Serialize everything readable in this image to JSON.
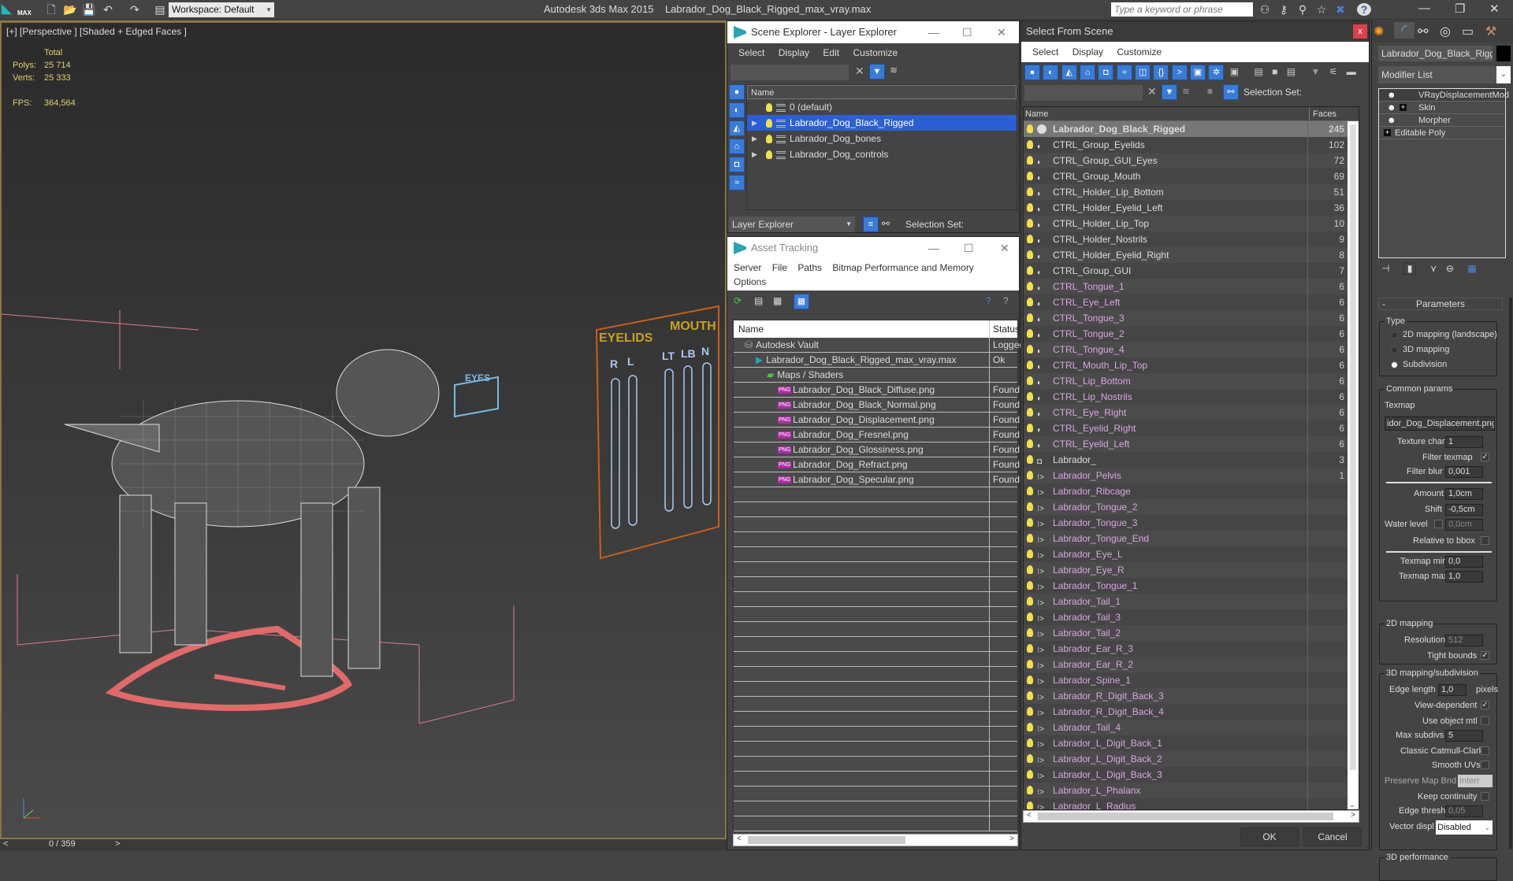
{
  "app": {
    "title": "Autodesk 3ds Max  2015",
    "file": "Labrador_Dog_Black_Rigged_max_vray.max",
    "logo_label": "MAX",
    "workspace": "Workspace: Default",
    "search_placeholder": "Type a keyword or phrase"
  },
  "viewport": {
    "label": "[+] [Perspective ] [Shaded + Edged Faces ]",
    "stats": {
      "total_label": "Total",
      "polys_label": "Polys:",
      "polys": "25 714",
      "verts_label": "Verts:",
      "verts": "25 333",
      "fps_label": "FPS:",
      "fps": "364,564"
    },
    "gui_labels": {
      "eyes": "EYES",
      "eyelids": "EYELIDS",
      "mouth": "MOUTH",
      "r": "R",
      "l": "L",
      "lt": "LT",
      "lb": "LB",
      "n": "N"
    },
    "timeline": {
      "frame": "0 / 359",
      "prev": "<",
      "next": ">"
    }
  },
  "scene_explorer": {
    "title": "Scene Explorer - Layer Explorer",
    "menu": [
      "Select",
      "Display",
      "Edit",
      "Customize"
    ],
    "column": "Name",
    "layers": [
      {
        "name": "0 (default)",
        "expandable": false,
        "selected": false
      },
      {
        "name": "Labrador_Dog_Black_Rigged",
        "expandable": true,
        "selected": true
      },
      {
        "name": "Labrador_Dog_bones",
        "expandable": true,
        "selected": false
      },
      {
        "name": "Labrador_Dog_controls",
        "expandable": true,
        "selected": false
      }
    ],
    "footer_mode": "Layer Explorer",
    "selection_set_label": "Selection Set:"
  },
  "asset_tracking": {
    "title": "Asset Tracking",
    "menu": [
      "Server",
      "File",
      "Paths",
      "Bitmap Performance and Memory",
      "Options"
    ],
    "columns": [
      "Name",
      "Status"
    ],
    "rows": [
      {
        "name": "Autodesk Vault",
        "status": "Logged",
        "indent": 1,
        "icon": "vault"
      },
      {
        "name": "Labrador_Dog_Black_Rigged_max_vray.max",
        "status": "Ok",
        "indent": 2,
        "icon": "max"
      },
      {
        "name": "Maps / Shaders",
        "status": "",
        "indent": 3,
        "icon": "maps"
      },
      {
        "name": "Labrador_Dog_Black_Diffuse.png",
        "status": "Found",
        "indent": 4,
        "icon": "png"
      },
      {
        "name": "Labrador_Dog_Black_Normal.png",
        "status": "Found",
        "indent": 4,
        "icon": "png"
      },
      {
        "name": "Labrador_Dog_Displacement.png",
        "status": "Found",
        "indent": 4,
        "icon": "png"
      },
      {
        "name": "Labrador_Dog_Fresnel.png",
        "status": "Found",
        "indent": 4,
        "icon": "png"
      },
      {
        "name": "Labrador_Dog_Glossiness.png",
        "status": "Found",
        "indent": 4,
        "icon": "png"
      },
      {
        "name": "Labrador_Dog_Refract.png",
        "status": "Found",
        "indent": 4,
        "icon": "png"
      },
      {
        "name": "Labrador_Dog_Specular.png",
        "status": "Found",
        "indent": 4,
        "icon": "png"
      }
    ]
  },
  "select_from_scene": {
    "title": "Select From Scene",
    "menu": [
      "Select",
      "Display",
      "Customize"
    ],
    "selection_set_label": "Selection Set:",
    "columns": [
      "Name",
      "Faces"
    ],
    "objects": [
      {
        "name": "Labrador_Dog_Black_Rigged",
        "faces": "245",
        "type": "geometry",
        "selected": true
      },
      {
        "name": "CTRL_Group_Eyelids",
        "faces": "102",
        "type": "shape"
      },
      {
        "name": "CTRL_Group_GUI_Eyes",
        "faces": "72",
        "type": "shape"
      },
      {
        "name": "CTRL_Group_Mouth",
        "faces": "69",
        "type": "shape"
      },
      {
        "name": "CTRL_Holder_Lip_Bottom",
        "faces": "51",
        "type": "shape"
      },
      {
        "name": "CTRL_Holder_Eyelid_Left",
        "faces": "36",
        "type": "shape"
      },
      {
        "name": "CTRL_Holder_Lip_Top",
        "faces": "10",
        "type": "shape"
      },
      {
        "name": "CTRL_Holder_Nostrils",
        "faces": "9",
        "type": "shape"
      },
      {
        "name": "CTRL_Holder_Eyelid_Right",
        "faces": "8",
        "type": "shape"
      },
      {
        "name": "CTRL_Group_GUI",
        "faces": "7",
        "type": "shape"
      },
      {
        "name": "CTRL_Tongue_1",
        "faces": "6",
        "type": "shape",
        "pink": true
      },
      {
        "name": "CTRL_Eye_Left",
        "faces": "6",
        "type": "shape",
        "pink": true
      },
      {
        "name": "CTRL_Tongue_3",
        "faces": "6",
        "type": "shape",
        "pink": true
      },
      {
        "name": "CTRL_Tongue_2",
        "faces": "6",
        "type": "shape",
        "pink": true
      },
      {
        "name": "CTRL_Tongue_4",
        "faces": "6",
        "type": "shape",
        "pink": true
      },
      {
        "name": "CTRL_Mouth_Lip_Top",
        "faces": "6",
        "type": "shape",
        "pink": true
      },
      {
        "name": "CTRL_Lip_Bottom",
        "faces": "6",
        "type": "shape",
        "pink": true
      },
      {
        "name": "CTRL_Lip_Nostrils",
        "faces": "6",
        "type": "shape",
        "pink": true
      },
      {
        "name": "CTRL_Eye_Right",
        "faces": "6",
        "type": "shape",
        "pink": true
      },
      {
        "name": "CTRL_Eyelid_Right",
        "faces": "6",
        "type": "shape",
        "pink": true
      },
      {
        "name": "CTRL_Eyelid_Left",
        "faces": "6",
        "type": "shape",
        "pink": true
      },
      {
        "name": "Labrador_",
        "faces": "3",
        "type": "helper"
      },
      {
        "name": "Labrador_Pelvis",
        "faces": "1",
        "type": "bone",
        "pink": true
      },
      {
        "name": "Labrador_Ribcage",
        "faces": "",
        "type": "bone",
        "pink": true
      },
      {
        "name": "Labrador_Tongue_2",
        "faces": "",
        "type": "bone",
        "pink": true
      },
      {
        "name": "Labrador_Tongue_3",
        "faces": "",
        "type": "bone",
        "pink": true
      },
      {
        "name": "Labrador_Tongue_End",
        "faces": "",
        "type": "bone",
        "pink": true
      },
      {
        "name": "Labrador_Eye_L",
        "faces": "",
        "type": "bone",
        "pink": true
      },
      {
        "name": "Labrador_Eye_R",
        "faces": "",
        "type": "bone",
        "pink": true
      },
      {
        "name": "Labrador_Tongue_1",
        "faces": "",
        "type": "bone",
        "pink": true
      },
      {
        "name": "Labrador_Tail_1",
        "faces": "",
        "type": "bone",
        "pink": true
      },
      {
        "name": "Labrador_Tail_3",
        "faces": "",
        "type": "bone",
        "pink": true
      },
      {
        "name": "Labrador_Tail_2",
        "faces": "",
        "type": "bone",
        "pink": true
      },
      {
        "name": "Labrador_Ear_R_3",
        "faces": "",
        "type": "bone",
        "pink": true
      },
      {
        "name": "Labrador_Ear_R_2",
        "faces": "",
        "type": "bone",
        "pink": true
      },
      {
        "name": "Labrador_Spine_1",
        "faces": "",
        "type": "bone",
        "pink": true
      },
      {
        "name": "Labrador_R_Digit_Back_3",
        "faces": "",
        "type": "bone",
        "pink": true
      },
      {
        "name": "Labrador_R_Digit_Back_4",
        "faces": "",
        "type": "bone",
        "pink": true
      },
      {
        "name": "Labrador_Tail_4",
        "faces": "",
        "type": "bone",
        "pink": true
      },
      {
        "name": "Labrador_L_Digit_Back_1",
        "faces": "",
        "type": "bone",
        "pink": true
      },
      {
        "name": "Labrador_L_Digit_Back_2",
        "faces": "",
        "type": "bone",
        "pink": true
      },
      {
        "name": "Labrador_L_Digit_Back_3",
        "faces": "",
        "type": "bone",
        "pink": true
      },
      {
        "name": "Labrador_L_Phalanx",
        "faces": "",
        "type": "bone",
        "pink": true
      },
      {
        "name": "Labrador_L_Radius",
        "faces": "",
        "type": "bone",
        "pink": true
      }
    ],
    "ok_label": "OK",
    "cancel_label": "Cancel"
  },
  "command_panel": {
    "object_name": "Labrador_Dog_Black_Rigged",
    "modifier_list": "Modifier List",
    "stack": [
      {
        "name": "VRayDisplacementMod",
        "bulb": true,
        "plus": false
      },
      {
        "name": "Skin",
        "bulb": true,
        "plus": true
      },
      {
        "name": "Morpher",
        "bulb": true,
        "plus": false
      },
      {
        "name": "Editable Poly",
        "bulb": false,
        "plus": true
      }
    ],
    "rollout": "Parameters",
    "type_group": "Type",
    "type_options": [
      "2D mapping (landscape)",
      "3D mapping",
      "Subdivision"
    ],
    "type_selected": "Subdivision",
    "common_group": "Common params",
    "texmap_label": "Texmap",
    "texmap_value": "idor_Dog_Displacement.png)",
    "texture_chan_label": "Texture chan",
    "texture_chan": "1",
    "filter_texmap_label": "Filter texmap",
    "filter_texmap": true,
    "filter_blur_label": "Filter blur",
    "filter_blur": "0,001",
    "amount_label": "Amount",
    "amount": "1,0cm",
    "shift_label": "Shift",
    "shift": "-0,5cm",
    "water_level_label": "Water level",
    "water_level": "0,0cm",
    "relative_bbox_label": "Relative to bbox",
    "texmap_min_label": "Texmap min",
    "texmap_min": "0,0",
    "texmap_max_label": "Texmap max",
    "texmap_max": "1,0",
    "mapping2d_group": "2D mapping",
    "resolution_label": "Resolution",
    "resolution": "512",
    "tight_bounds_label": "Tight bounds",
    "mapping3d_group": "3D mapping/subdivision",
    "edge_length_label": "Edge length",
    "edge_length": "1,0",
    "pixels_label": "pixels",
    "view_dependent_label": "View-dependent",
    "use_object_mtl_label": "Use object mtl",
    "max_subdivs_label": "Max subdivs",
    "max_subdivs": "5",
    "classic_cc_label": "Classic Catmull-Clark",
    "smooth_uvs_label": "Smooth UVs",
    "preserve_map_label": "Preserve Map Bnd",
    "preserve_map": "Interr",
    "keep_continuity_label": "Keep continuity",
    "edge_thresh_label": "Edge thresh",
    "edge_thresh": "0,05",
    "vector_displ_label": "Vector displ",
    "vector_displ": "Disabled",
    "perf_group": "3D performance"
  }
}
